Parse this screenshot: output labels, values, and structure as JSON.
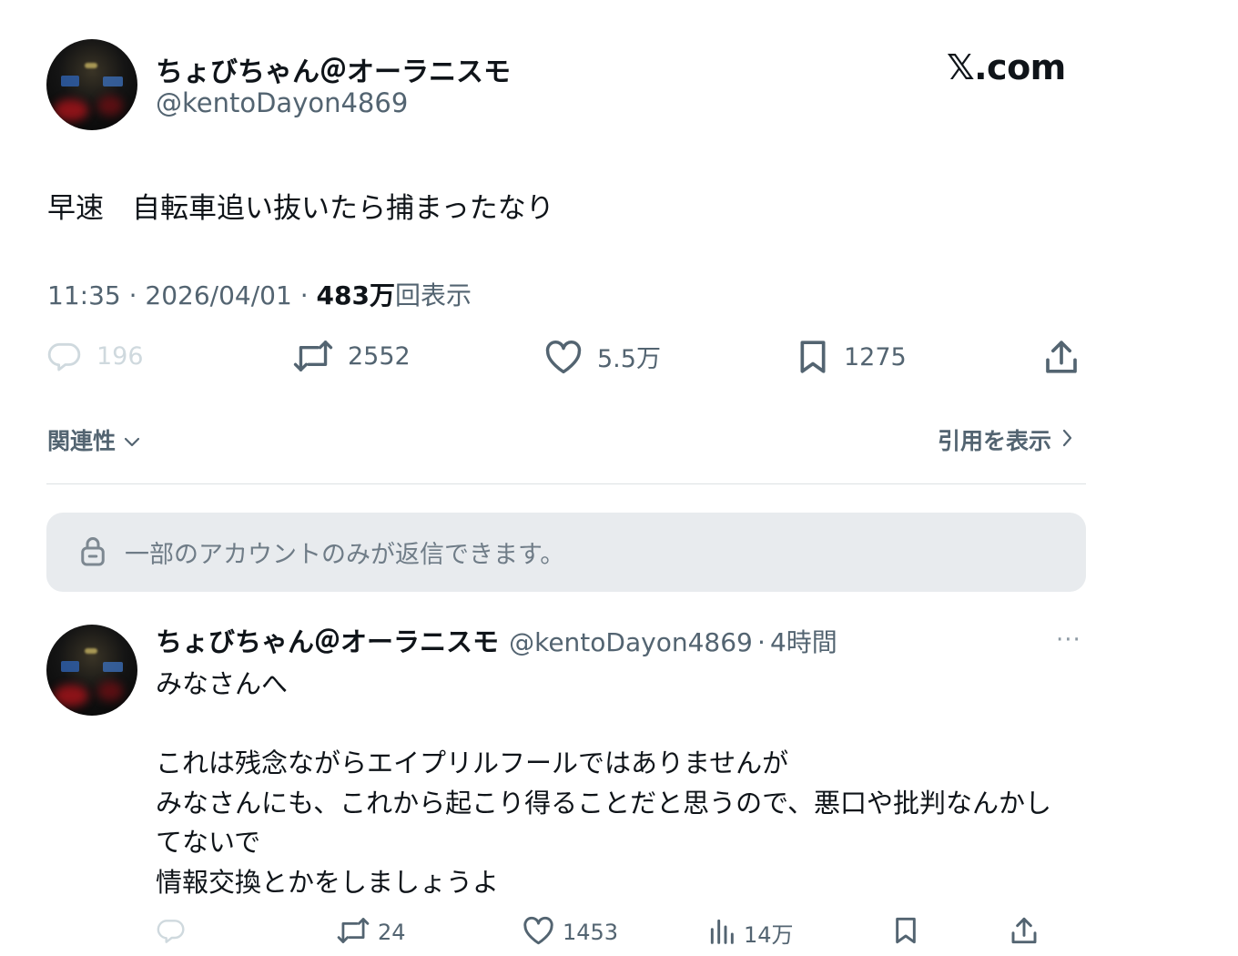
{
  "post": {
    "display_name": "ちょびちゃん＠オーラニスモ",
    "handle": "@kentoDayon4869",
    "site_logo": "𝕏.com",
    "text": "早速　自転車追い抜いたら捕まったなり",
    "time": "11:35",
    "date": "2026/04/01",
    "views_count": "483万",
    "views_label": "回表示",
    "sep": "·",
    "actions": {
      "reply_count": "196",
      "repost_count": "2552",
      "like_count": "5.5万",
      "bookmark_count": "1275"
    },
    "relevance_label": "関連性",
    "view_quotes_label": "引用を表示",
    "reply_restriction": "一部のアカウントのみが返信できます。"
  },
  "reply": {
    "display_name": "ちょびちゃん＠オーラニスモ",
    "handle": "@kentoDayon4869",
    "sep": "·",
    "time_ago": "4時間",
    "more": "···",
    "lines": [
      "みなさんへ",
      "",
      "これは残念ながらエイプリルフールではありませんが",
      "みなさんにも、これから起こり得ることだと思うので、悪口や批判なんかし",
      "てないで",
      "情報交換とかをしましょうよ"
    ],
    "actions": {
      "repost_count": "24",
      "like_count": "1453",
      "views_count": "14万"
    }
  },
  "colors": {
    "text": "#0f1419",
    "secondary": "#536471",
    "muted": "#cfd9de",
    "panel": "#e8ebee"
  }
}
